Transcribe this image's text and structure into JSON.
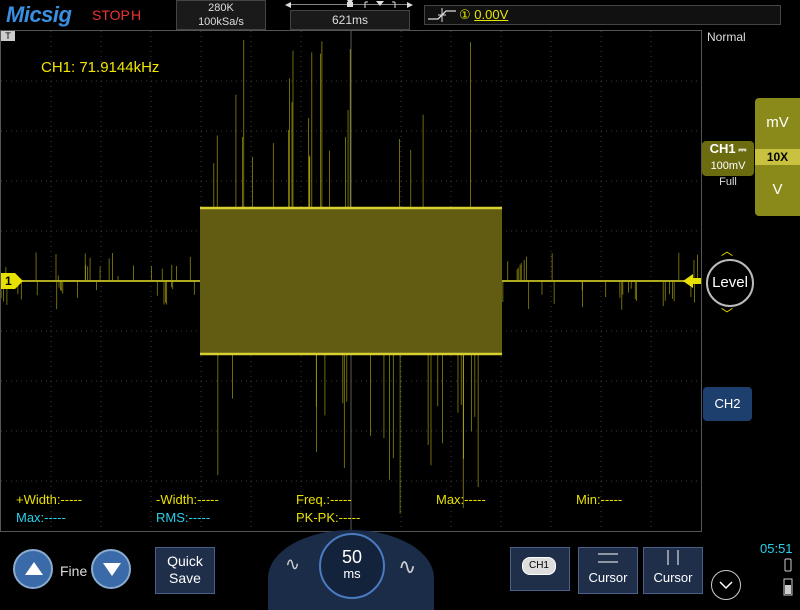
{
  "header": {
    "logo": "Micsig",
    "run_status": "STOP",
    "mode": "H",
    "memory_depth": "280K",
    "sample_rate": "100kSa/s",
    "timebase_position": "621ms",
    "trigger_source": "①",
    "trigger_level": "0.00V"
  },
  "screen": {
    "frequency_readout": "CH1: 71.9144kHz",
    "ch1_marker": "1",
    "measurements_row1": [
      {
        "label": "+Width:-----"
      },
      {
        "label": "-Width:-----"
      },
      {
        "label": "Freq.:-----"
      },
      {
        "label": "Max:-----"
      },
      {
        "label": "Min:-----"
      }
    ],
    "measurements_row2": [
      {
        "label": "Max:-----"
      },
      {
        "label": "RMS:-----"
      },
      {
        "label": "PK-PK:-----"
      }
    ]
  },
  "right_panel": {
    "trigger_mode": "Normal",
    "ch1_name": "CH1",
    "ch1_coupling_icon": "dc-coupling-icon",
    "ch1_scale": "100mV",
    "ch1_bandwidth": "Full",
    "probe_unit_top": "mV",
    "probe_ratio": "10X",
    "probe_unit_bottom": "V",
    "level_label": "Level",
    "ch2_label": "CH2"
  },
  "bottom": {
    "fine_label": "Fine",
    "quick_save_line1": "Quick",
    "quick_save_line2": "Save",
    "timebase_value": "50",
    "timebase_unit": "ms",
    "ch1_select_label": "CH1",
    "cursor_label_1": "Cursor",
    "cursor_label_2": "Cursor",
    "clock": "05:51"
  },
  "colors": {
    "ch1": "#e8e000",
    "ch2_button": "#1d3f6e",
    "accent_blue": "#3a6aa8",
    "stop_red": "#ee3333",
    "measure_cyan": "#2ad0ea"
  }
}
